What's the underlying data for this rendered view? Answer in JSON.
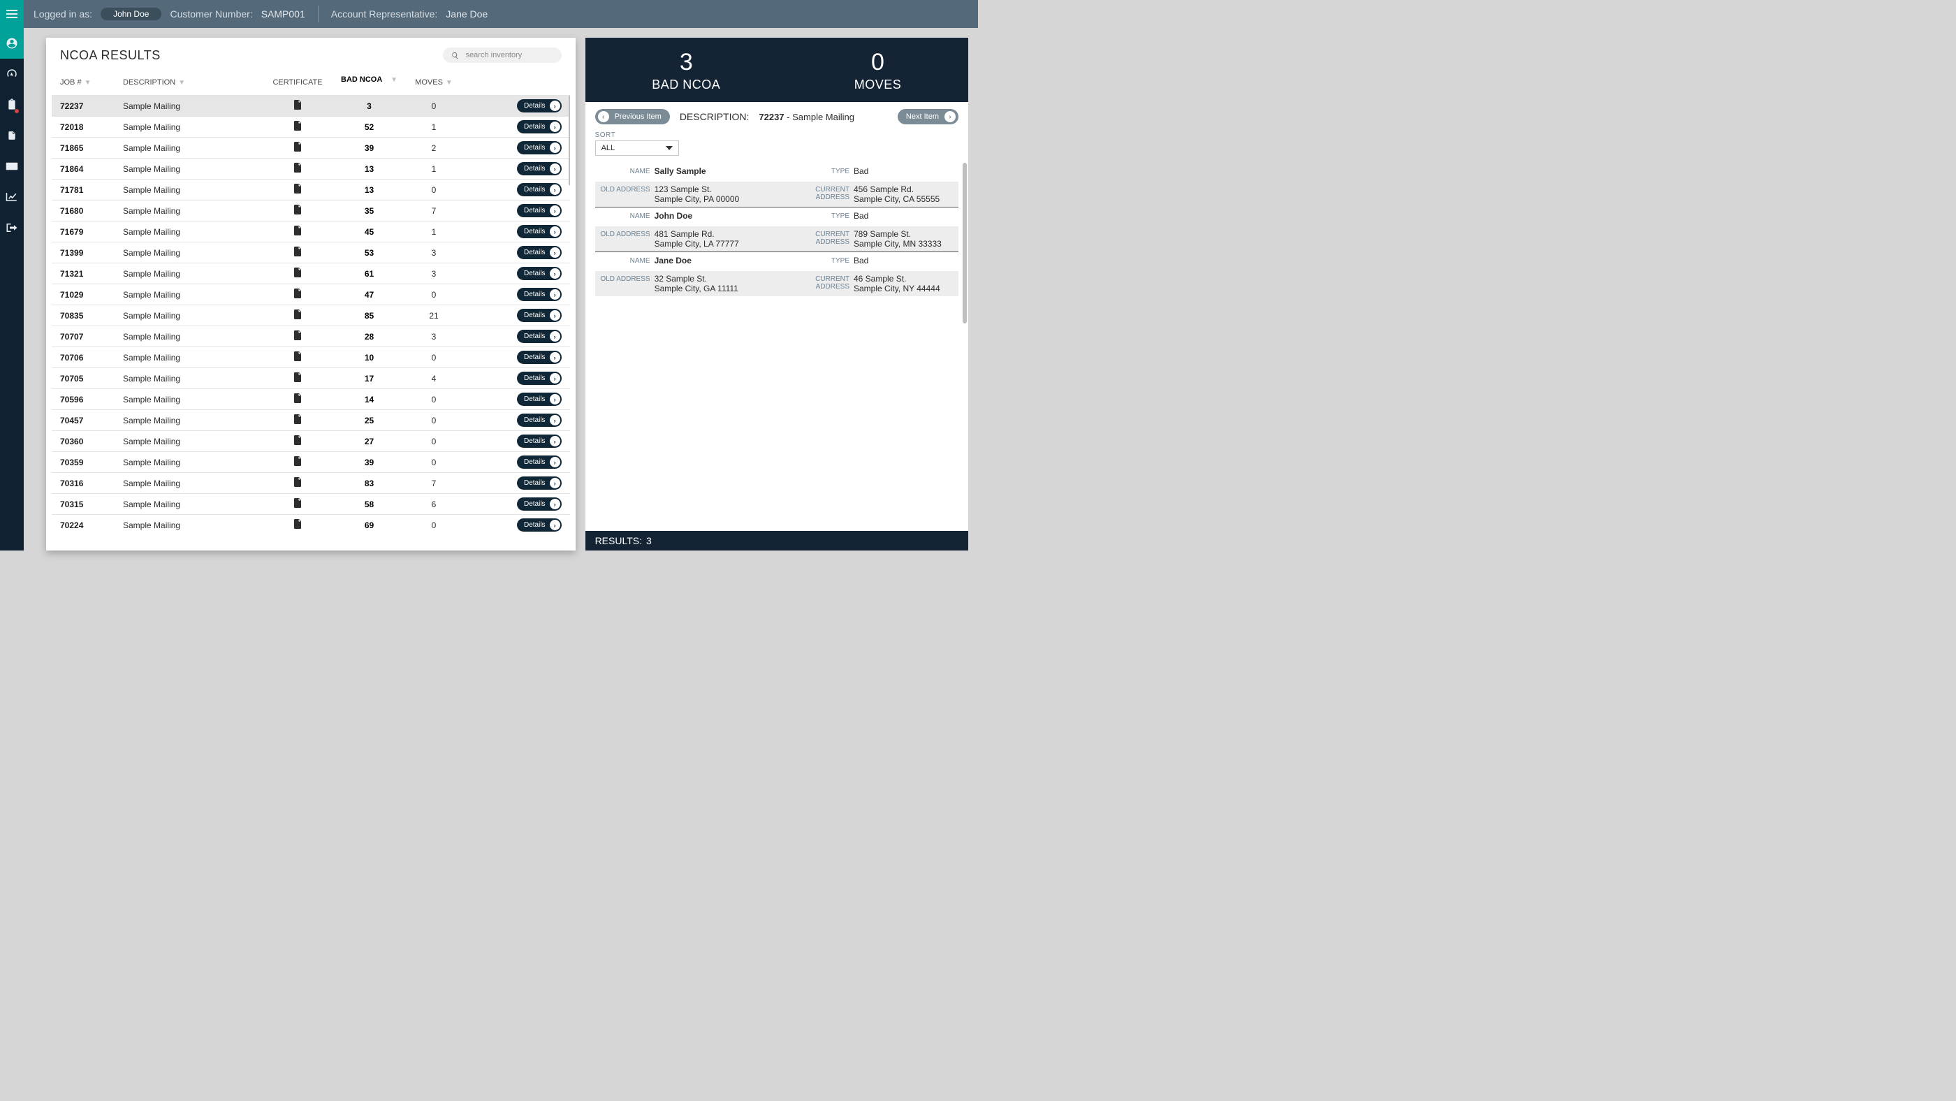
{
  "topbar": {
    "loggedInLabel": "Logged in as:",
    "loggedInUser": "John Doe",
    "custNumLabel": "Customer Number:",
    "custNum": "SAMP001",
    "repLabel": "Account Representative:",
    "repName": "Jane Doe"
  },
  "left": {
    "title": "NCOA RESULTS",
    "searchPlaceholder": "search inventory",
    "headers": {
      "job": "JOB #",
      "desc": "DESCRIPTION",
      "cert": "CERTIFICATE",
      "bad": "BAD NCOA",
      "moves": "MOVES"
    },
    "detailsLabel": "Details",
    "rows": [
      {
        "job": "72237",
        "desc": "Sample Mailing",
        "bad": "3",
        "moves": "0",
        "sel": true
      },
      {
        "job": "72018",
        "desc": "Sample Mailing",
        "bad": "52",
        "moves": "1"
      },
      {
        "job": "71865",
        "desc": "Sample Mailing",
        "bad": "39",
        "moves": "2"
      },
      {
        "job": "71864",
        "desc": "Sample Mailing",
        "bad": "13",
        "moves": "1"
      },
      {
        "job": "71781",
        "desc": "Sample Mailing",
        "bad": "13",
        "moves": "0"
      },
      {
        "job": "71680",
        "desc": "Sample Mailing",
        "bad": "35",
        "moves": "7"
      },
      {
        "job": "71679",
        "desc": "Sample Mailing",
        "bad": "45",
        "moves": "1"
      },
      {
        "job": "71399",
        "desc": "Sample Mailing",
        "bad": "53",
        "moves": "3"
      },
      {
        "job": "71321",
        "desc": "Sample Mailing",
        "bad": "61",
        "moves": "3"
      },
      {
        "job": "71029",
        "desc": "Sample Mailing",
        "bad": "47",
        "moves": "0"
      },
      {
        "job": "70835",
        "desc": "Sample Mailing",
        "bad": "85",
        "moves": "21"
      },
      {
        "job": "70707",
        "desc": "Sample Mailing",
        "bad": "28",
        "moves": "3"
      },
      {
        "job": "70706",
        "desc": "Sample Mailing",
        "bad": "10",
        "moves": "0"
      },
      {
        "job": "70705",
        "desc": "Sample Mailing",
        "bad": "17",
        "moves": "4"
      },
      {
        "job": "70596",
        "desc": "Sample Mailing",
        "bad": "14",
        "moves": "0"
      },
      {
        "job": "70457",
        "desc": "Sample Mailing",
        "bad": "25",
        "moves": "0"
      },
      {
        "job": "70360",
        "desc": "Sample Mailing",
        "bad": "27",
        "moves": "0"
      },
      {
        "job": "70359",
        "desc": "Sample Mailing",
        "bad": "39",
        "moves": "0"
      },
      {
        "job": "70316",
        "desc": "Sample Mailing",
        "bad": "83",
        "moves": "7"
      },
      {
        "job": "70315",
        "desc": "Sample Mailing",
        "bad": "58",
        "moves": "6"
      },
      {
        "job": "70224",
        "desc": "Sample Mailing",
        "bad": "69",
        "moves": "0"
      }
    ]
  },
  "right": {
    "summary": {
      "badNum": "3",
      "badLabel": "BAD NCOA",
      "movesNum": "0",
      "movesLabel": "MOVES"
    },
    "nav": {
      "prev": "Previous Item",
      "next": "Next Item",
      "descLabel": "DESCRIPTION:",
      "descJob": "72237",
      "descSep": " - ",
      "descName": "Sample Mailing"
    },
    "sort": {
      "label": "SORT",
      "value": "ALL"
    },
    "labels": {
      "name": "NAME",
      "type": "TYPE",
      "oldAddr": "OLD ADDRESS",
      "curAddr": "CURRENT ADDRESS"
    },
    "records": [
      {
        "name": "Sally Sample",
        "type": "Bad",
        "old1": "123 Sample St.",
        "old2": "Sample City, PA 00000",
        "cur1": "456 Sample Rd.",
        "cur2": "Sample City, CA 55555"
      },
      {
        "name": "John Doe",
        "type": "Bad",
        "old1": "481 Sample Rd.",
        "old2": "Sample City, LA 77777",
        "cur1": "789 Sample St.",
        "cur2": "Sample City, MN 33333"
      },
      {
        "name": "Jane Doe",
        "type": "Bad",
        "old1": "32 Sample St.",
        "old2": "Sample City, GA 11111",
        "cur1": "46 Sample St.",
        "cur2": "Sample City, NY 44444"
      }
    ],
    "resultsLabel": "RESULTS:",
    "resultsNum": "3"
  }
}
